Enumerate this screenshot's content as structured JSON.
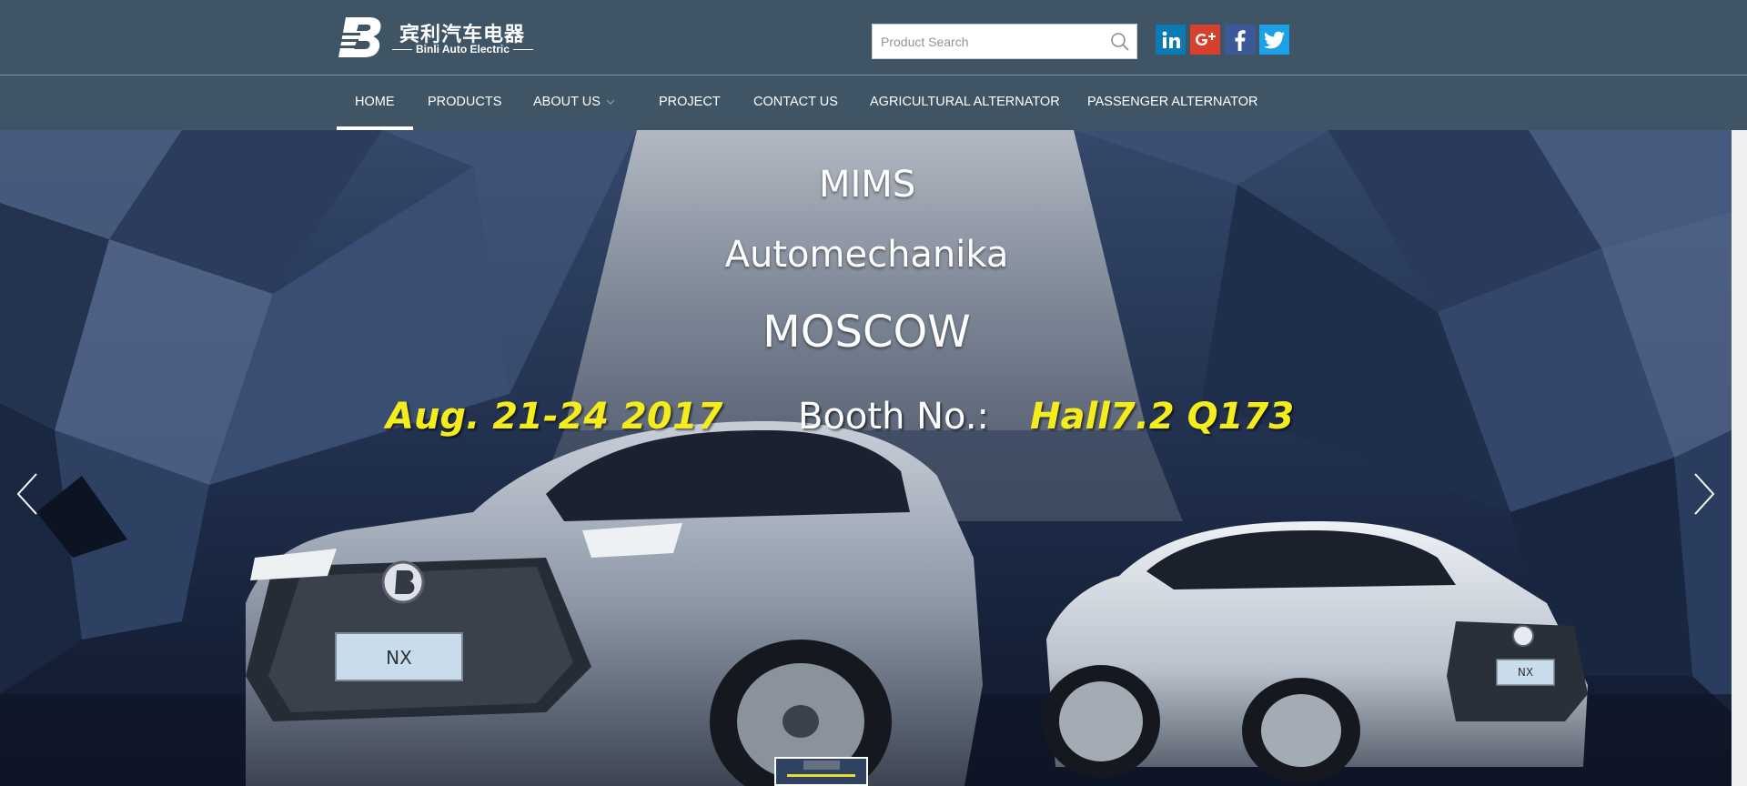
{
  "brand": {
    "name_cn": "宾利汽车电器",
    "name_en": "Binli Auto Electric",
    "logo_icon": "b-logo-icon"
  },
  "search": {
    "placeholder": "Product Search",
    "value": "",
    "icon": "search-icon"
  },
  "social": [
    {
      "name": "linkedin",
      "icon": "linkedin-icon",
      "color": "#0a7bb5"
    },
    {
      "name": "google-plus",
      "icon": "google-plus-icon",
      "color": "#d6412d"
    },
    {
      "name": "facebook",
      "icon": "facebook-icon",
      "color": "#3b5998"
    },
    {
      "name": "twitter",
      "icon": "twitter-icon",
      "color": "#1ca0e6"
    }
  ],
  "nav": {
    "items": [
      {
        "label": "HOME",
        "active": true
      },
      {
        "label": "PRODUCTS",
        "active": false
      },
      {
        "label": "ABOUT US",
        "active": false,
        "has_dropdown": true
      },
      {
        "label": "PROJECT",
        "active": false
      },
      {
        "label": "CONTACT US",
        "active": false
      },
      {
        "label": "AGRICULTURAL ALTERNATOR",
        "active": false
      },
      {
        "label": "PASSENGER ALTERNATOR",
        "active": false
      }
    ]
  },
  "banner": {
    "line1": "MIMS",
    "line2": "Automechanika",
    "line3": "MOSCOW",
    "date": "Aug. 21-24 2017",
    "booth_label": "Booth No.:",
    "booth_value": "Hall7.2 Q173",
    "car1_plate": "NX",
    "car2_plate": "NX",
    "prev_icon": "chevron-left-icon",
    "next_icon": "chevron-right-icon"
  },
  "colors": {
    "header_bg": "#3f5566",
    "accent_yellow": "#f5ec1c",
    "text": "#ffffff"
  }
}
